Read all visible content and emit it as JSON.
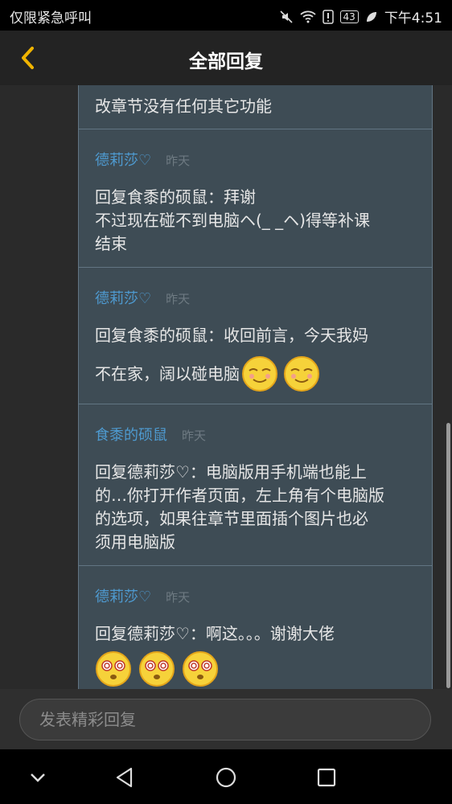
{
  "status_bar": {
    "carrier": "仅限紧急呼叫",
    "battery": "43",
    "time": "下午4:51"
  },
  "header": {
    "title": "全部回复"
  },
  "replies": [
    {
      "body_lines": [
        "改章节没有任何其它功能"
      ]
    },
    {
      "name": "德莉莎♡",
      "time": "昨天",
      "body_lines": [
        "回复食黍的硕鼠：拜谢",
        "不过现在碰不到电脑ヘ(_ _ヘ)得等补课",
        "结束"
      ]
    },
    {
      "name": "德莉莎♡",
      "time": "昨天",
      "body_lines": [
        "回复食黍的硕鼠：收回前言，今天我妈",
        "不在家，阔以碰电脑"
      ]
    },
    {
      "name": "食黍的硕鼠",
      "time": "昨天",
      "body_lines": [
        "回复德莉莎♡：电脑版用手机端也能上",
        "的…你打开作者页面，左上角有个电脑版",
        "的选项，如果往章节里面插个图片也必",
        "须用电脑版"
      ]
    },
    {
      "name": "德莉莎♡",
      "time": "昨天",
      "body_lines": [
        "回复德莉莎♡：啊这。。。谢谢大佬"
      ]
    }
  ],
  "input": {
    "placeholder": "发表精彩回复"
  },
  "icons": {
    "back": "chevron-left-icon",
    "emoji_smirk": "smirk-emoji-icon",
    "emoji_dizzy": "dizzy-emoji-icon"
  },
  "colors": {
    "accent": "#f0b400",
    "username": "#4e9ad0",
    "card_bg": "#3e4c55"
  }
}
